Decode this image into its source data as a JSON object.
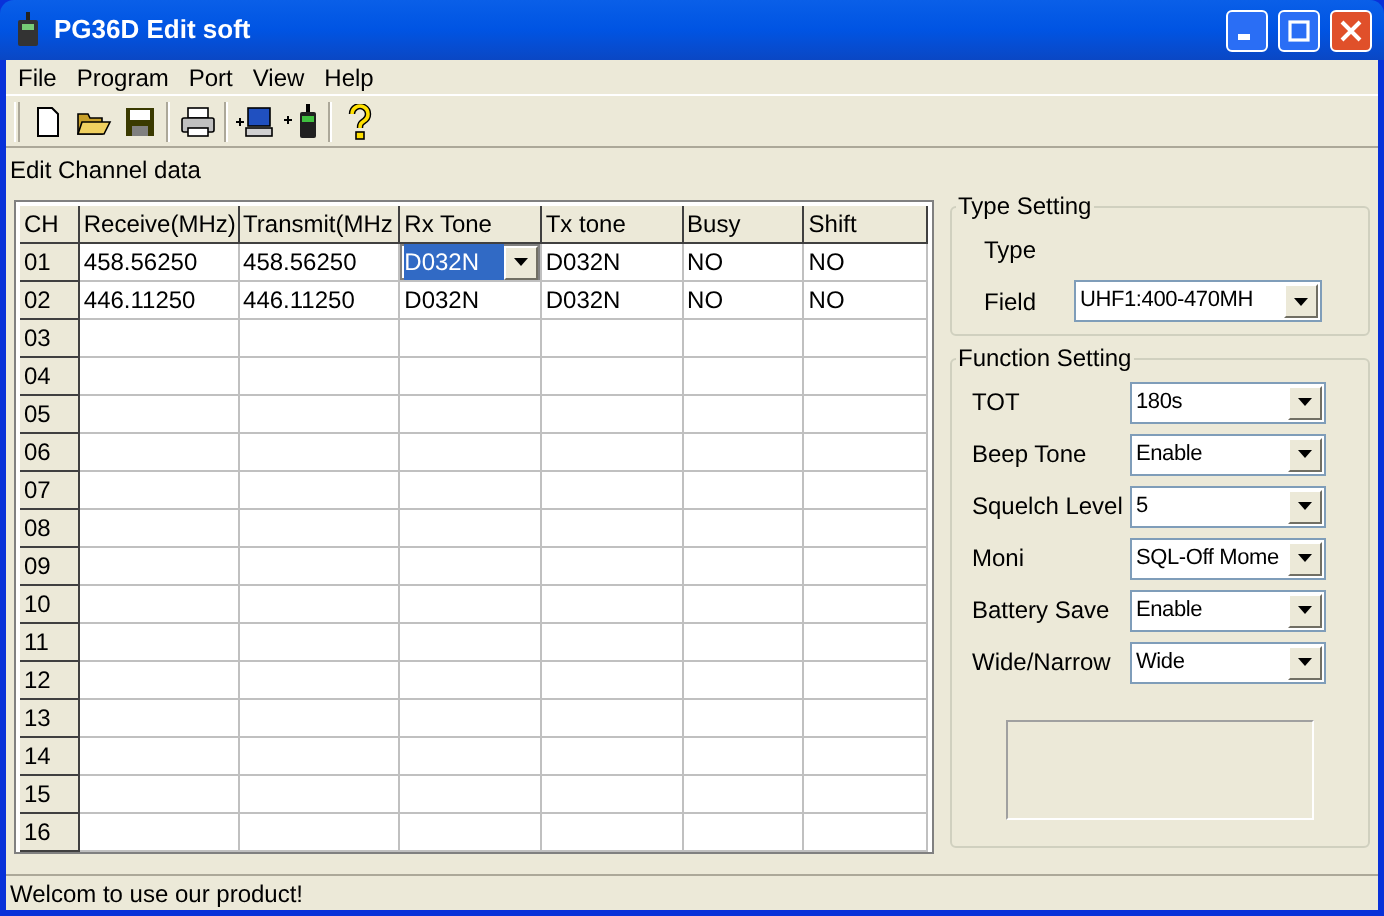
{
  "window": {
    "title": "PG36D Edit soft"
  },
  "menu": [
    "File",
    "Program",
    "Port",
    "View",
    "Help"
  ],
  "section_label": "Edit Channel data",
  "table": {
    "columns": [
      "CH",
      "Receive(MHz)",
      "Transmit(MHz",
      "Rx Tone",
      "Tx tone",
      "Busy",
      "Shift"
    ],
    "rows": [
      {
        "ch": "01",
        "cells": [
          {
            "kind": "text",
            "text": "458.56250"
          },
          {
            "kind": "text",
            "text": "458.56250"
          },
          {
            "kind": "dropdown",
            "text": "D032N",
            "selected": true
          },
          {
            "kind": "text",
            "text": "D032N"
          },
          {
            "kind": "text",
            "text": "NO"
          },
          {
            "kind": "text",
            "text": "NO"
          }
        ]
      },
      {
        "ch": "02",
        "cells": [
          {
            "kind": "text",
            "text": "446.11250"
          },
          {
            "kind": "text",
            "text": "446.11250"
          },
          {
            "kind": "text",
            "text": "D032N"
          },
          {
            "kind": "text",
            "text": "D032N"
          },
          {
            "kind": "text",
            "text": "NO"
          },
          {
            "kind": "text",
            "text": "NO"
          }
        ]
      },
      {
        "ch": "03"
      },
      {
        "ch": "04"
      },
      {
        "ch": "05"
      },
      {
        "ch": "06"
      },
      {
        "ch": "07"
      },
      {
        "ch": "08"
      },
      {
        "ch": "09"
      },
      {
        "ch": "10"
      },
      {
        "ch": "11"
      },
      {
        "ch": "12"
      },
      {
        "ch": "13"
      },
      {
        "ch": "14"
      },
      {
        "ch": "15"
      },
      {
        "ch": "16"
      }
    ]
  },
  "type_setting": {
    "title": "Type Setting",
    "type_label": "Type",
    "field_label": "Field",
    "field_value": "UHF1:400-470MH"
  },
  "function_setting": {
    "title": "Function Setting",
    "items": [
      {
        "label": "TOT",
        "value": "180s"
      },
      {
        "label": "Beep Tone",
        "value": "Enable"
      },
      {
        "label": "Squelch Level",
        "value": "5"
      },
      {
        "label": "Moni",
        "value": "SQL-Off Mome"
      },
      {
        "label": "Battery Save",
        "value": "Enable"
      },
      {
        "label": "Wide/Narrow",
        "value": "Wide"
      }
    ]
  },
  "status_bar": "Welcom to use our product!"
}
